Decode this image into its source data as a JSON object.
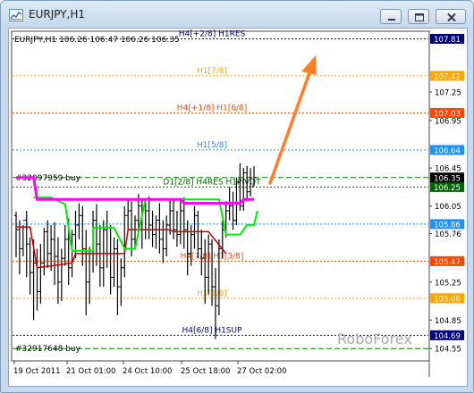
{
  "window": {
    "title": "EURJPY,H1"
  },
  "chart_header": "EURJPY,H1  106.26 106.47 106.26 106.35",
  "watermark": "RoboForex",
  "colors": {
    "frame_bg": "#c9daee",
    "chart_bg": "#ffffff",
    "axis": "#444444",
    "candle": "#000000",
    "trend_magenta": "#ff00ff",
    "trend_green": "#00ee00",
    "trend_red": "#cc0000",
    "arrow": "#ff7f27",
    "watermark": "#a9a9a9"
  },
  "chart_data": {
    "type": "candlestick",
    "y_range": [
      104.43,
      107.88
    ],
    "x_labels": [
      "19 Oct 2011",
      "21 Oct 01:00",
      "24 Oct 10:00",
      "25 Oct 18:00",
      "27 Oct 02:00"
    ],
    "price_ticks": [
      "107.81",
      "107.42",
      "107.25",
      "107.03",
      "106.95",
      "106.64",
      "106.45",
      "106.35",
      "106.25",
      "106.05",
      "105.86",
      "105.76",
      "105.47",
      "105.25",
      "105.08",
      "104.85",
      "104.69",
      "104.55"
    ],
    "levels": [
      {
        "price": 107.81,
        "label": "H4[+2/8] H1RES",
        "color": "#00007f",
        "tag": "107.81"
      },
      {
        "price": 107.42,
        "label": "H1[7/8]",
        "color": "#ffa500",
        "tag": "107.42"
      },
      {
        "price": 107.03,
        "label": "H4[+1/8] H1[6/8]",
        "color": "#ff4500",
        "tag": "107.03"
      },
      {
        "price": 106.64,
        "label": "H1[5/8]",
        "color": "#1e90ff",
        "tag": "106.64"
      },
      {
        "price": 106.25,
        "label": "D1[2/8] H4RES H1PIVOT",
        "color": "#006400",
        "tag": "106.25"
      },
      {
        "price": 105.86,
        "label": "",
        "color": "#1e90ff",
        "tag": "105.86"
      },
      {
        "price": 105.47,
        "label": "H4[7/8] H1[3/8]",
        "color": "#ff4500",
        "tag": "105.47"
      },
      {
        "price": 105.08,
        "label": "H1[1/8]",
        "color": "#ffa500",
        "tag": "105.08"
      },
      {
        "price": 104.69,
        "label": "H4[6/8] H1SUP",
        "color": "#00007f",
        "tag": "104.69"
      }
    ],
    "current_price": {
      "value": 106.35,
      "tag": "106.35"
    },
    "order_lines": [
      {
        "price": 106.35,
        "label": "#32097959 buy"
      },
      {
        "price": 104.55,
        "label": "#32917648 buy"
      }
    ],
    "magenta_line": [
      {
        "i": 0,
        "y": 106.35
      },
      {
        "i": 5,
        "y": 106.35
      },
      {
        "i": 6,
        "y": 106.12
      },
      {
        "i": 47,
        "y": 106.12
      },
      {
        "i": 48,
        "y": 106.08
      },
      {
        "i": 64,
        "y": 106.08
      },
      {
        "i": 65,
        "y": 106.12
      },
      {
        "i": 68,
        "y": 106.12
      }
    ],
    "red_line": [
      {
        "i": 0,
        "y": 105.83
      },
      {
        "i": 4,
        "y": 105.83
      },
      {
        "i": 6,
        "y": 105.4
      },
      {
        "i": 16,
        "y": 105.45
      },
      {
        "i": 17,
        "y": 105.55
      },
      {
        "i": 31,
        "y": 105.55
      },
      {
        "i": 32,
        "y": 105.8
      },
      {
        "i": 44,
        "y": 105.8
      },
      {
        "i": 45,
        "y": 105.78
      },
      {
        "i": 55,
        "y": 105.78
      },
      {
        "i": 60,
        "y": 105.55
      }
    ],
    "green_line": [
      {
        "i": 5,
        "y": 106.14
      },
      {
        "i": 10,
        "y": 106.14
      },
      {
        "i": 14,
        "y": 106.07
      },
      {
        "i": 16,
        "y": 105.58
      },
      {
        "i": 22,
        "y": 105.58
      },
      {
        "i": 22,
        "y": 105.82
      },
      {
        "i": 28,
        "y": 105.82
      },
      {
        "i": 31,
        "y": 105.6
      },
      {
        "i": 34,
        "y": 105.6
      },
      {
        "i": 37,
        "y": 106.12
      },
      {
        "i": 58,
        "y": 106.12
      },
      {
        "i": 60,
        "y": 105.75
      },
      {
        "i": 64,
        "y": 105.75
      },
      {
        "i": 66,
        "y": 105.85
      },
      {
        "i": 68,
        "y": 105.85
      },
      {
        "i": 69,
        "y": 106.0
      }
    ],
    "candles": [
      {
        "o": 105.95,
        "h": 105.99,
        "c": 105.8,
        "l": 105.51
      },
      {
        "o": 105.8,
        "h": 105.9,
        "c": 105.6,
        "l": 105.33
      },
      {
        "o": 105.6,
        "h": 105.85,
        "c": 105.9,
        "l": 105.52
      },
      {
        "o": 105.9,
        "h": 106.0,
        "c": 105.65,
        "l": 105.3
      },
      {
        "o": 105.65,
        "h": 105.72,
        "c": 105.35,
        "l": 105.12
      },
      {
        "o": 105.35,
        "h": 105.7,
        "c": 105.45,
        "l": 104.85
      },
      {
        "o": 105.45,
        "h": 105.6,
        "c": 105.15,
        "l": 104.95
      },
      {
        "o": 105.15,
        "h": 105.65,
        "c": 105.45,
        "l": 105.02
      },
      {
        "o": 105.45,
        "h": 105.82,
        "c": 105.78,
        "l": 105.32
      },
      {
        "o": 105.78,
        "h": 105.9,
        "c": 105.55,
        "l": 105.4
      },
      {
        "o": 105.55,
        "h": 105.85,
        "c": 105.7,
        "l": 105.37
      },
      {
        "o": 105.7,
        "h": 105.88,
        "c": 105.52,
        "l": 105.22
      },
      {
        "o": 105.52,
        "h": 105.72,
        "c": 105.25,
        "l": 105.02
      },
      {
        "o": 105.25,
        "h": 105.6,
        "c": 105.5,
        "l": 105.05
      },
      {
        "o": 105.5,
        "h": 105.85,
        "c": 105.7,
        "l": 105.42
      },
      {
        "o": 105.7,
        "h": 105.92,
        "c": 105.4,
        "l": 105.22
      },
      {
        "o": 105.4,
        "h": 105.8,
        "c": 105.75,
        "l": 105.3
      },
      {
        "o": 105.75,
        "h": 106.0,
        "c": 105.85,
        "l": 105.5
      },
      {
        "o": 105.85,
        "h": 106.08,
        "c": 105.95,
        "l": 105.7
      },
      {
        "o": 105.95,
        "h": 106.05,
        "c": 105.6,
        "l": 105.42
      },
      {
        "o": 105.6,
        "h": 105.8,
        "c": 105.25,
        "l": 104.9
      },
      {
        "o": 105.25,
        "h": 105.62,
        "c": 105.55,
        "l": 105.02
      },
      {
        "o": 105.55,
        "h": 106.0,
        "c": 105.9,
        "l": 105.35
      },
      {
        "o": 105.9,
        "h": 106.07,
        "c": 105.65,
        "l": 105.42
      },
      {
        "o": 105.65,
        "h": 105.85,
        "c": 105.4,
        "l": 105.2
      },
      {
        "o": 105.4,
        "h": 105.9,
        "c": 105.8,
        "l": 105.2
      },
      {
        "o": 105.8,
        "h": 106.0,
        "c": 105.55,
        "l": 105.4
      },
      {
        "o": 105.55,
        "h": 105.85,
        "c": 105.3,
        "l": 105.12
      },
      {
        "o": 105.3,
        "h": 105.72,
        "c": 105.6,
        "l": 105.2
      },
      {
        "o": 105.6,
        "h": 105.7,
        "c": 105.2,
        "l": 104.9
      },
      {
        "o": 105.2,
        "h": 105.5,
        "c": 105.4,
        "l": 105.0
      },
      {
        "o": 105.4,
        "h": 106.05,
        "c": 105.95,
        "l": 105.3
      },
      {
        "o": 105.95,
        "h": 106.12,
        "c": 106.0,
        "l": 105.8
      },
      {
        "o": 106.0,
        "h": 106.1,
        "c": 105.7,
        "l": 105.52
      },
      {
        "o": 105.7,
        "h": 105.95,
        "c": 105.9,
        "l": 105.6
      },
      {
        "o": 105.9,
        "h": 106.18,
        "c": 106.05,
        "l": 105.8
      },
      {
        "o": 106.05,
        "h": 106.13,
        "c": 105.8,
        "l": 105.6
      },
      {
        "o": 105.8,
        "h": 106.1,
        "c": 106.0,
        "l": 105.7
      },
      {
        "o": 106.0,
        "h": 106.15,
        "c": 105.85,
        "l": 105.7
      },
      {
        "o": 105.85,
        "h": 106.0,
        "c": 105.75,
        "l": 105.62
      },
      {
        "o": 105.75,
        "h": 105.95,
        "c": 105.9,
        "l": 105.6
      },
      {
        "o": 105.9,
        "h": 106.08,
        "c": 105.7,
        "l": 105.55
      },
      {
        "o": 105.7,
        "h": 105.9,
        "c": 105.6,
        "l": 105.45
      },
      {
        "o": 105.6,
        "h": 105.95,
        "c": 105.85,
        "l": 105.52
      },
      {
        "o": 105.85,
        "h": 106.12,
        "c": 106.0,
        "l": 105.75
      },
      {
        "o": 106.0,
        "h": 106.12,
        "c": 105.8,
        "l": 105.7
      },
      {
        "o": 105.8,
        "h": 106.0,
        "c": 105.75,
        "l": 105.62
      },
      {
        "o": 105.75,
        "h": 106.1,
        "c": 106.0,
        "l": 105.65
      },
      {
        "o": 106.0,
        "h": 106.14,
        "c": 105.8,
        "l": 105.6
      },
      {
        "o": 105.8,
        "h": 105.9,
        "c": 105.55,
        "l": 105.32
      },
      {
        "o": 105.55,
        "h": 105.85,
        "c": 105.75,
        "l": 105.42
      },
      {
        "o": 105.75,
        "h": 106.05,
        "c": 105.95,
        "l": 105.6
      },
      {
        "o": 105.95,
        "h": 106.0,
        "c": 105.6,
        "l": 105.5
      },
      {
        "o": 105.6,
        "h": 105.8,
        "c": 105.5,
        "l": 105.32
      },
      {
        "o": 105.5,
        "h": 105.7,
        "c": 105.3,
        "l": 105.02
      },
      {
        "o": 105.3,
        "h": 105.75,
        "c": 105.65,
        "l": 105.12
      },
      {
        "o": 105.65,
        "h": 105.7,
        "c": 105.2,
        "l": 105.0
      },
      {
        "o": 105.2,
        "h": 105.4,
        "c": 105.0,
        "l": 104.65
      },
      {
        "o": 105.0,
        "h": 105.7,
        "c": 105.6,
        "l": 104.9
      },
      {
        "o": 105.6,
        "h": 105.9,
        "c": 105.8,
        "l": 105.5
      },
      {
        "o": 105.8,
        "h": 106.1,
        "c": 106.0,
        "l": 105.72
      },
      {
        "o": 106.0,
        "h": 106.25,
        "c": 106.05,
        "l": 105.9
      },
      {
        "o": 106.05,
        "h": 106.2,
        "c": 105.9,
        "l": 105.8
      },
      {
        "o": 105.9,
        "h": 106.35,
        "c": 106.3,
        "l": 105.85
      },
      {
        "o": 106.3,
        "h": 106.5,
        "c": 106.05,
        "l": 106.0
      },
      {
        "o": 106.05,
        "h": 106.45,
        "c": 106.4,
        "l": 106.0
      },
      {
        "o": 106.4,
        "h": 106.47,
        "c": 106.2,
        "l": 106.1
      },
      {
        "o": 106.2,
        "h": 106.45,
        "c": 106.35,
        "l": 106.15
      },
      {
        "o": 106.26,
        "h": 106.47,
        "c": 106.35,
        "l": 106.26
      }
    ]
  }
}
